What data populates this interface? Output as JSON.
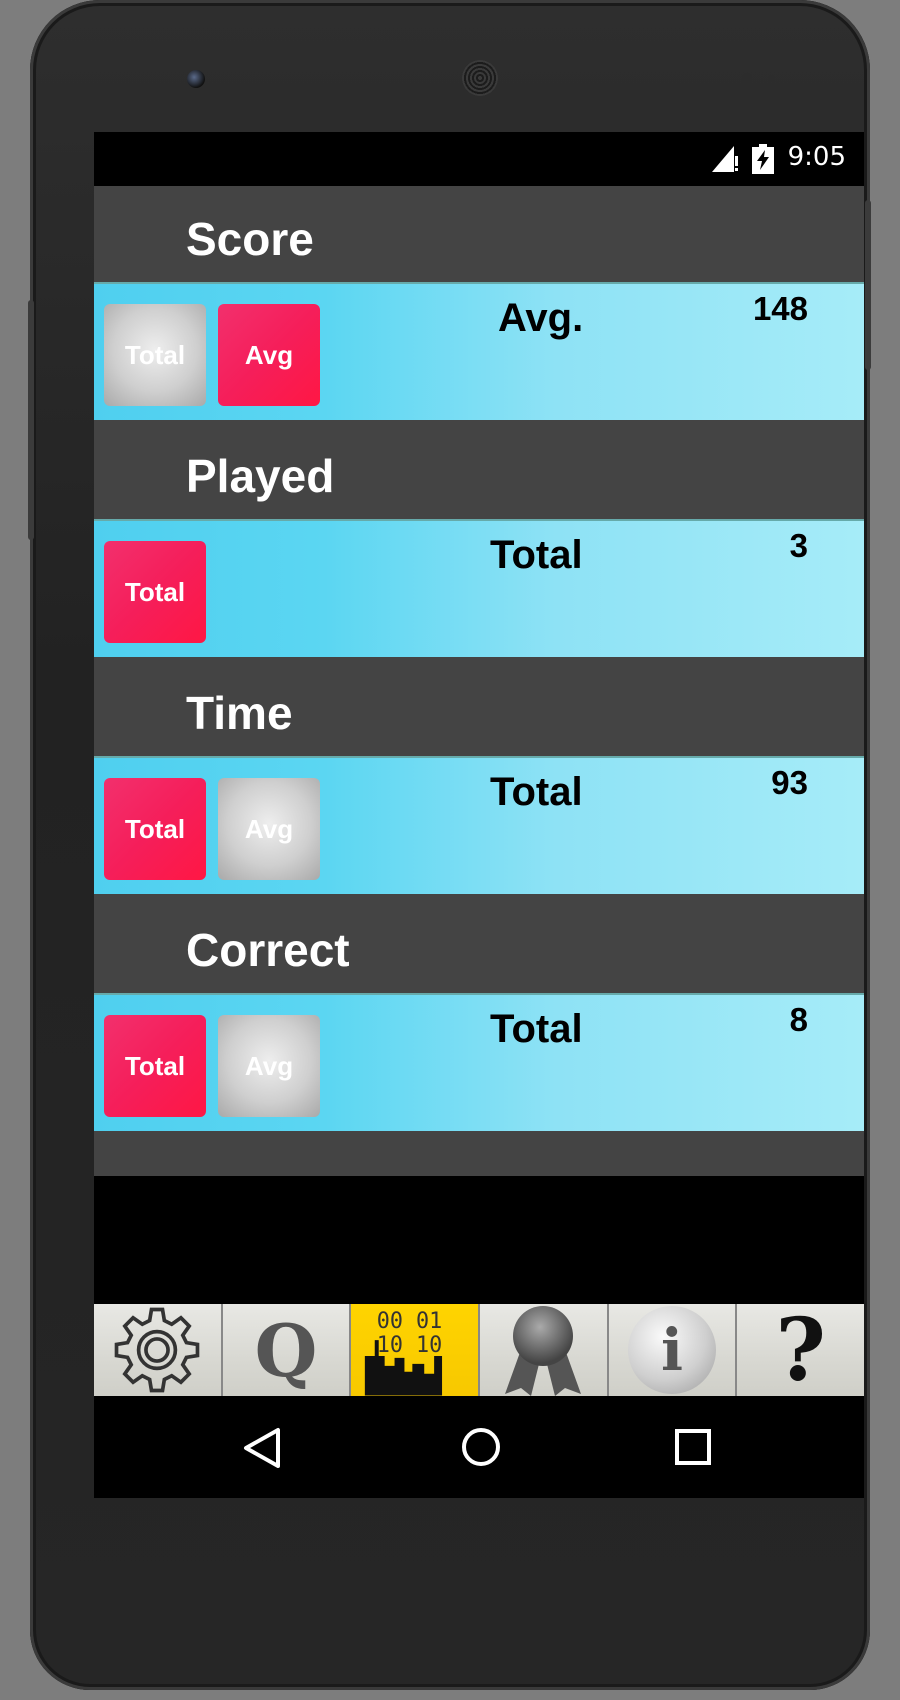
{
  "status_bar": {
    "time": "9:05"
  },
  "sections": [
    {
      "title": "Score",
      "tiles": [
        {
          "label": "Total",
          "active": false
        },
        {
          "label": "Avg",
          "active": true
        }
      ],
      "metric_label": "Avg.",
      "value": "148"
    },
    {
      "title": "Played",
      "tiles": [
        {
          "label": "Total",
          "active": true
        }
      ],
      "metric_label": "Total",
      "value": "3"
    },
    {
      "title": "Time",
      "tiles": [
        {
          "label": "Total",
          "active": true
        },
        {
          "label": "Avg",
          "active": false
        }
      ],
      "metric_label": "Total",
      "value": "93"
    },
    {
      "title": "Correct",
      "tiles": [
        {
          "label": "Total",
          "active": true
        },
        {
          "label": "Avg",
          "active": false
        }
      ],
      "metric_label": "Total",
      "value": "8"
    }
  ],
  "tab_bar": {
    "tabs": [
      {
        "icon": "gear-icon",
        "active": false
      },
      {
        "icon": "quiz-q-icon",
        "glyph": "Q",
        "active": false
      },
      {
        "icon": "stats-icon",
        "glyph_lines": [
          "00 01",
          "10 10"
        ],
        "active": true
      },
      {
        "icon": "award-ribbon-icon",
        "active": false
      },
      {
        "icon": "info-icon",
        "glyph": "i",
        "active": false
      },
      {
        "icon": "help-icon",
        "glyph": "?",
        "active": false
      }
    ]
  },
  "nav_bar": {
    "buttons": [
      "back-icon",
      "home-icon",
      "recents-icon"
    ]
  },
  "colors": {
    "tile_active": "#f51e5a",
    "row_gradient_start": "#4fcfef",
    "row_gradient_end": "#a6ecf8",
    "section_bg": "#444444",
    "tab_active": "#ffd400"
  }
}
